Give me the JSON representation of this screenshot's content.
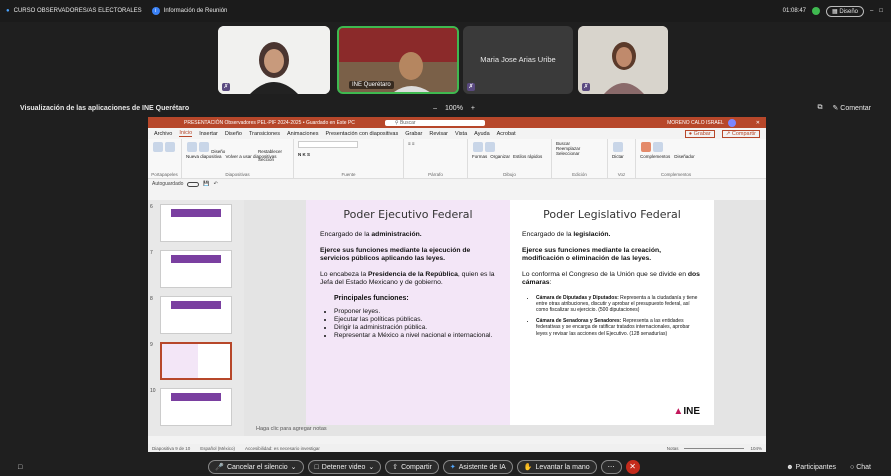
{
  "meeting": {
    "title": "CURSO OBSERVADORES/AS ELECTORALES",
    "info": "Información de Reunión",
    "timer": "01:08:47",
    "layout_button": "Diseño"
  },
  "participants": [
    {
      "name": ""
    },
    {
      "name": "INE Querétaro"
    },
    {
      "name": "Maria Jose Arias Uribe"
    },
    {
      "name": ""
    }
  ],
  "share": {
    "title": "Visualización de las aplicaciones de INE Querétaro",
    "zoom": "100%",
    "comment_label": "Comentar"
  },
  "ppt": {
    "window_title": "PRESENTACIÓN Observadores PEL-PIF 2024-2025 • Guardado en Este PC",
    "search": "Buscar",
    "user": "MORENO CALO ISRAEL",
    "menu": [
      "Archivo",
      "Inicio",
      "Insertar",
      "Diseño",
      "Transiciones",
      "Animaciones",
      "Presentación con diapositivas",
      "Grabar",
      "Revisar",
      "Vista",
      "Ayuda",
      "Acrobat"
    ],
    "record_btn": "Grabar",
    "share_btn": "Compartir",
    "ribbon_groups": [
      "Portapapeles",
      "Diapositivas",
      "Fuente",
      "Párrafo",
      "Dibujo",
      "Edición",
      "Voz",
      "Complementos"
    ],
    "ribbon_buttons": {
      "new_slide": "Nueva diapositiva",
      "reuse": "Volver a usar diapositivas",
      "layout": "Diseño",
      "reset": "Restablecer",
      "section": "Sección",
      "shapes": "Formas",
      "arrange": "Organizar",
      "quick_styles": "Estilos rápidos",
      "find": "Buscar",
      "replace": "Reemplazar",
      "select": "Seleccionar",
      "dictate": "Dictar",
      "addins": "Complementos",
      "designer": "Diseñador"
    },
    "autosave": "Autoguardado",
    "thumb_numbers": [
      "6",
      "7",
      "8",
      "9",
      "10"
    ],
    "notes_placeholder": "Haga clic para agregar notas",
    "status_left": "Diapositiva 9 de 10",
    "status_lang": "Español (México)",
    "status_access": "Accesibilidad: es necesario investigar",
    "status_notes": "Notas",
    "zoom": "104%"
  },
  "slide": {
    "left": {
      "title": "Poder Ejecutivo Federal",
      "p1_pre": "Encargado de la ",
      "p1_bold": "administración.",
      "p2": "Ejerce sus funciones mediante la ejecución de servicios públicos aplicando las leyes.",
      "p3_pre": "Lo encabeza la ",
      "p3_bold": "Presidencia de la República",
      "p3_post": ", quien es la Jefa del Estado Mexicano y de gobierno.",
      "sub": "Principales funciones:",
      "items": [
        "Proponer leyes.",
        "Ejecutar las políticas públicas.",
        "Dirigir la administración pública.",
        "Representar a México a nivel nacional e internacional."
      ]
    },
    "right": {
      "title": "Poder Legislativo Federal",
      "p1_pre": "Encargado de la ",
      "p1_bold": "legislación.",
      "p2": "Ejerce sus funciones mediante la creación, modificación o eliminación de las leyes.",
      "p3_pre": "Lo conforma el Congreso de la Unión que se divide en ",
      "p3_bold": "dos cámaras",
      "p3_post": ":",
      "c1_bold": "Cámara de Diputadas y Diputados:",
      "c1_text": " Representa a la ciudadanía y tiene entre otras atribuciones, discutir y aprobar el presupuesto federal, así como fiscalizar su ejercicio. (500 diputaciones)",
      "c2_bold": "Cámara de Senadoras y Senadores:",
      "c2_text": " Representa a las entidades federativas y se encarga de ratificar tratados internacionales, aprobar leyes y revisar las acciones del Ejecutivo. (128 senadurías)",
      "logo": "INE"
    }
  },
  "controls": {
    "mute": "Cancelar el silencio",
    "video": "Detener video",
    "share": "Compartir",
    "ai": "Asistente de IA",
    "hand": "Levantar la mano",
    "participants": "Participantes",
    "chat": "Chat"
  }
}
